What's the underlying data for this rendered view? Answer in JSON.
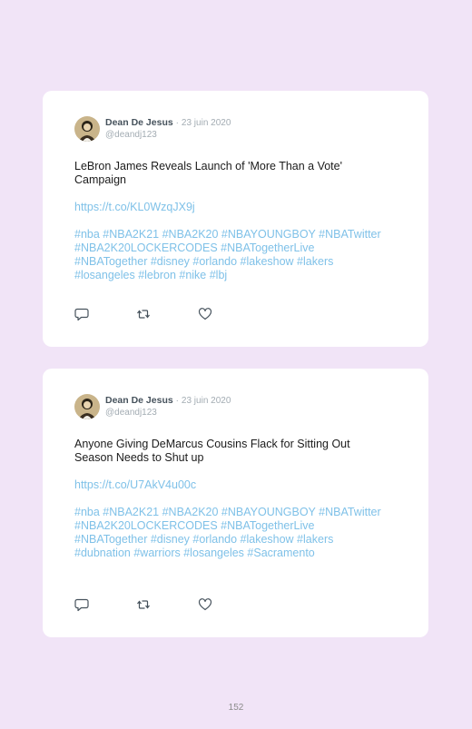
{
  "tweets": [
    {
      "author": "Dean De Jesus",
      "separator": "·",
      "date": "23 juin 2020",
      "handle": "@deandj123",
      "text": "LeBron James Reveals Launch of 'More Than a Vote' Campaign",
      "link": "https://t.co/KL0WzqJX9j",
      "hashtags": "#nba #NBA2K21 #NBA2K20 #NBAYOUNGBOY #NBATwitter #NBA2K20LOCKERCODES #NBATogetherLive #NBATogether #disney #orlando #lakeshow #lakers #losangeles #lebron #nike #lbj"
    },
    {
      "author": "Dean De Jesus",
      "separator": "·",
      "date": "23 juin 2020",
      "handle": "@deandj123",
      "text": "Anyone Giving DeMarcus Cousins Flack for Sitting Out Season Needs to Shut up",
      "link": "https://t.co/U7AkV4u00c",
      "hashtags": "#nba #NBA2K21 #NBA2K20 #NBAYOUNGBOY #NBATwitter #NBA2K20LOCKERCODES #NBATogetherLive #NBATogether #disney #orlando #lakeshow #lakers #dubnation #warriors #losangeles #Sacramento"
    }
  ],
  "icons": {
    "reply": "reply-icon",
    "retweet": "retweet-icon",
    "like": "heart-icon"
  },
  "colors": {
    "background": "#f1e4f7",
    "card": "#ffffff",
    "link": "#7fc1e8",
    "muted": "#a3acb3"
  },
  "page_number": "152"
}
